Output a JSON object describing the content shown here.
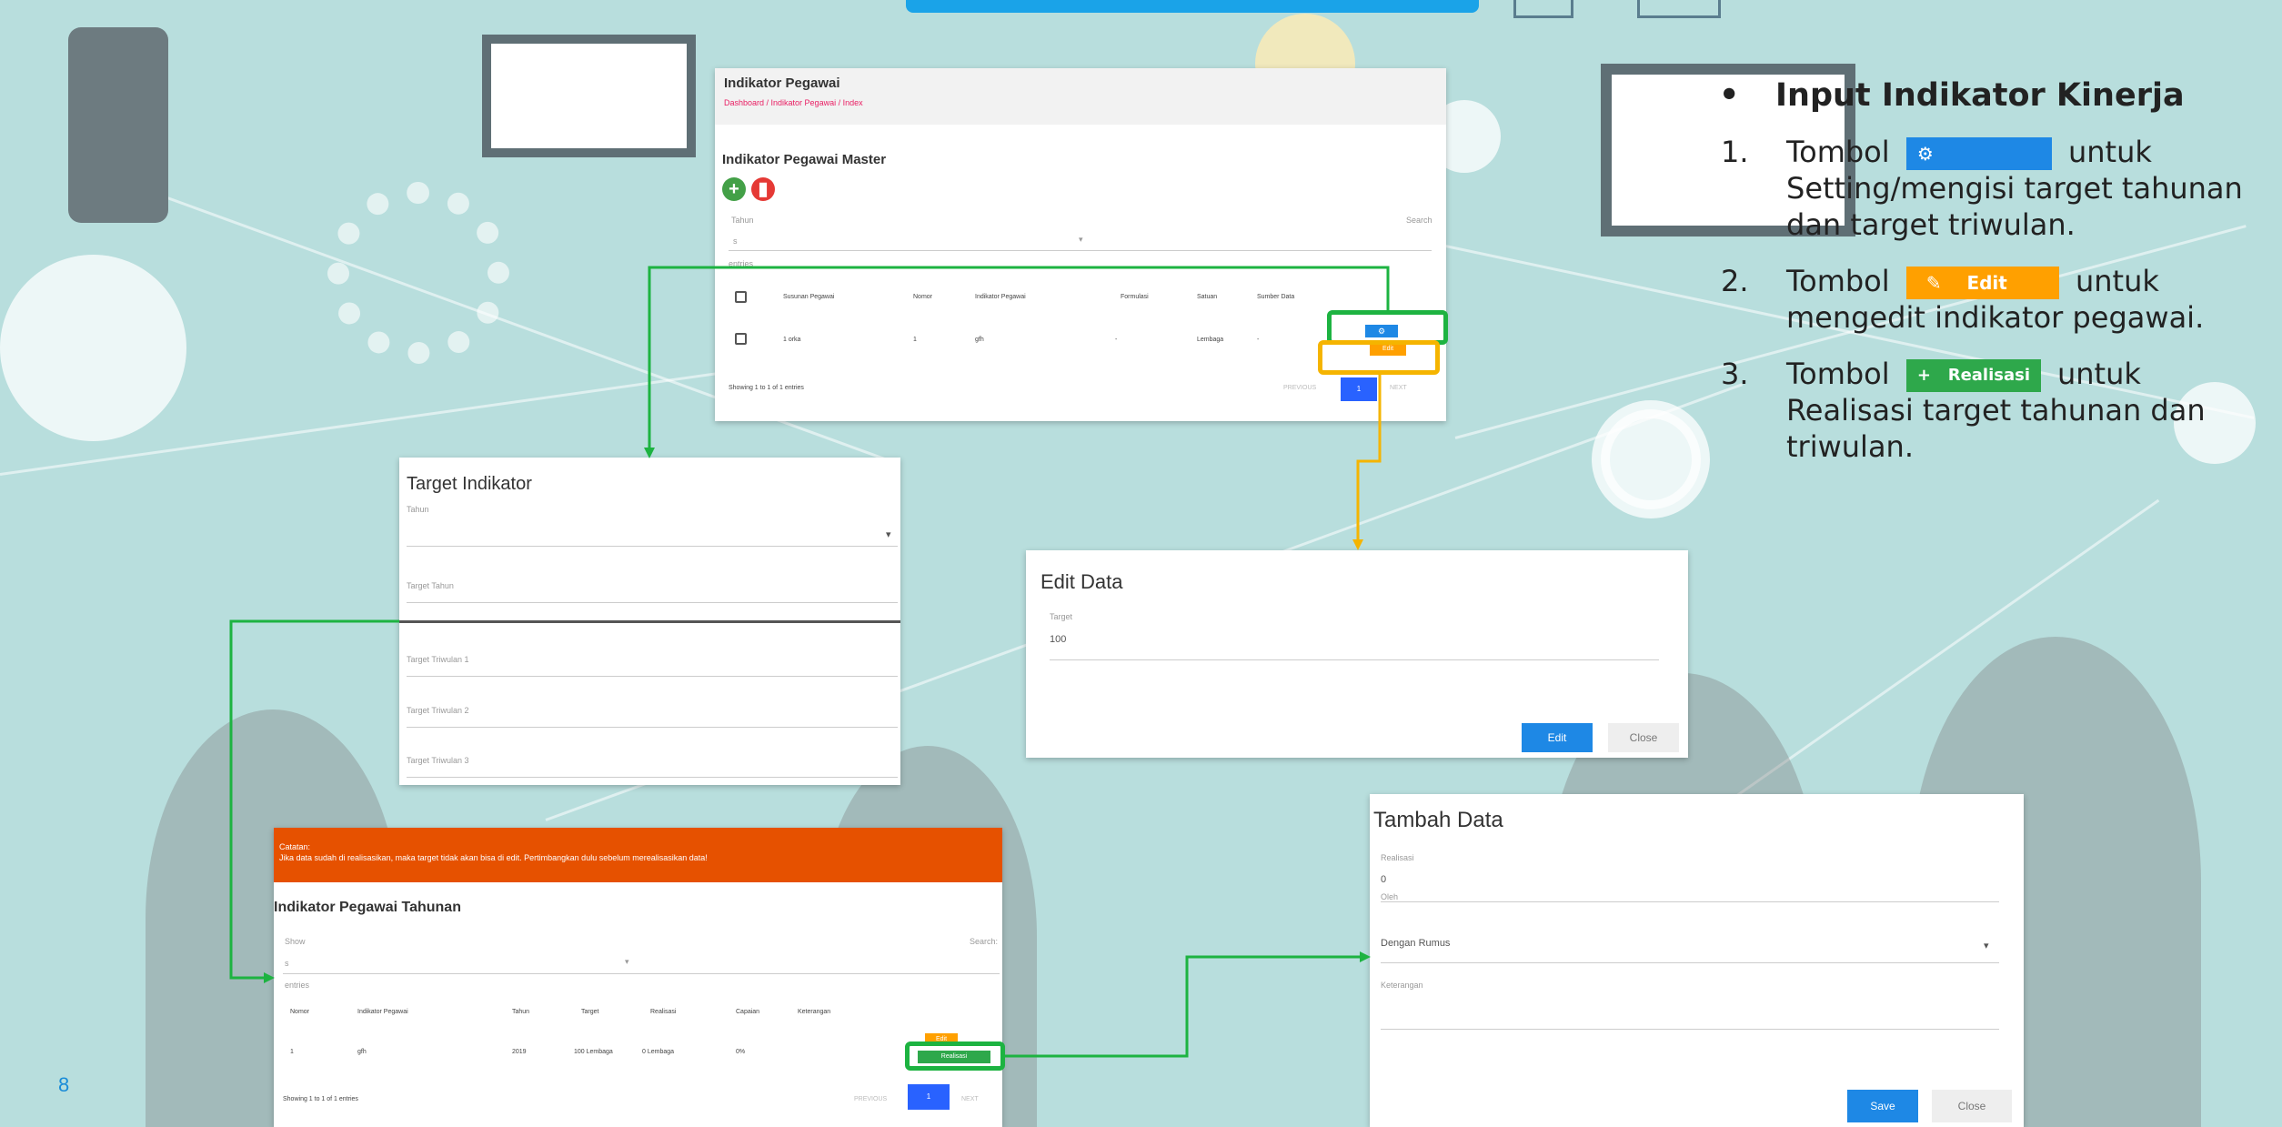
{
  "slide": {
    "page_number": "8"
  },
  "instructions": {
    "bullet": "•",
    "heading": "Input Indikator Kinerja",
    "items": [
      {
        "num": "1.",
        "prefix": "Tombol",
        "suffix": "untuk",
        "text": "Setting/mengisi target tahunan dan target triwulan.",
        "button_label": ""
      },
      {
        "num": "2.",
        "prefix": "Tombol",
        "suffix": "untuk",
        "text": "mengedit indikator pegawai.",
        "button_label": "Edit"
      },
      {
        "num": "3.",
        "prefix": "Tombol",
        "suffix": "untuk",
        "text": "Realisasi target tahunan dan triwulan.",
        "button_label": "Realisasi"
      }
    ]
  },
  "panel_master": {
    "title": "Indikator Pegawai",
    "breadcrumb": "Dashboard / Indikator Pegawai / Index",
    "subtitle": "Indikator Pegawai Master",
    "filter_label": "Tahun",
    "filter_value": "s",
    "search_label": "Search",
    "entries_label": "entries",
    "columns": [
      "Susunan Pegawai",
      "Nomor",
      "Indikator Pegawai",
      "Formulasi",
      "Satuan",
      "Sumber Data"
    ],
    "row": [
      "1 orka",
      "1",
      "gfh",
      "-",
      "Lembaga",
      "-"
    ],
    "footer": "Showing 1 to 1 of 1 entries",
    "pager": {
      "prev": "PREVIOUS",
      "page": "1",
      "next": "NEXT"
    },
    "edit_small": "Edit"
  },
  "panel_target": {
    "title": "Target Indikator",
    "field_tahun": "Tahun",
    "field_target_tahun": "Target Tahun",
    "field_tw1": "Target Triwulan 1",
    "field_tw2": "Target Triwulan 2",
    "field_tw3": "Target Triwulan 3"
  },
  "panel_edit": {
    "title": "Edit Data",
    "field_label": "Target",
    "field_value": "100",
    "edit_button": "Edit",
    "close_button": "Close"
  },
  "panel_tahunan": {
    "warning_title": "Catatan:",
    "warning_text": "Jika data sudah di realisasikan, maka target tidak akan bisa di edit. Pertimbangkan dulu sebelum merealisasikan data!",
    "title": "Indikator Pegawai Tahunan",
    "filter_label": "Show",
    "filter_value": "s",
    "search_label": "Search:",
    "entries_label": "entries",
    "columns": [
      "Nomor",
      "Indikator Pegawai",
      "Tahun",
      "Target",
      "Realisasi",
      "Capaian",
      "Keterangan"
    ],
    "row": [
      "1",
      "gfh",
      "2019",
      "100 Lembaga",
      "0 Lembaga",
      "0%",
      ""
    ],
    "footer": "Showing 1 to 1 of 1 entries",
    "pager": {
      "prev": "PREVIOUS",
      "page": "1",
      "next": "NEXT"
    },
    "edit_small": "Edit",
    "realisasi_small": "Realisasi"
  },
  "panel_tambah": {
    "title": "Tambah Data",
    "field_realisasi": "Realisasi",
    "realisasi_value": "0",
    "field_satuan": "Oleh",
    "select_value": "Dengan Rumus",
    "field_keterangan": "Keterangan",
    "save_button": "Save",
    "close_button": "Close"
  },
  "colors": {
    "blue_btn": "#1e88e5",
    "edit_btn": "#ffa000",
    "realisasi_btn": "#2ea84b",
    "highlight_green": "#1db341",
    "highlight_yellow": "#f5b400",
    "warning": "#e65100",
    "delete": "#e53935"
  }
}
